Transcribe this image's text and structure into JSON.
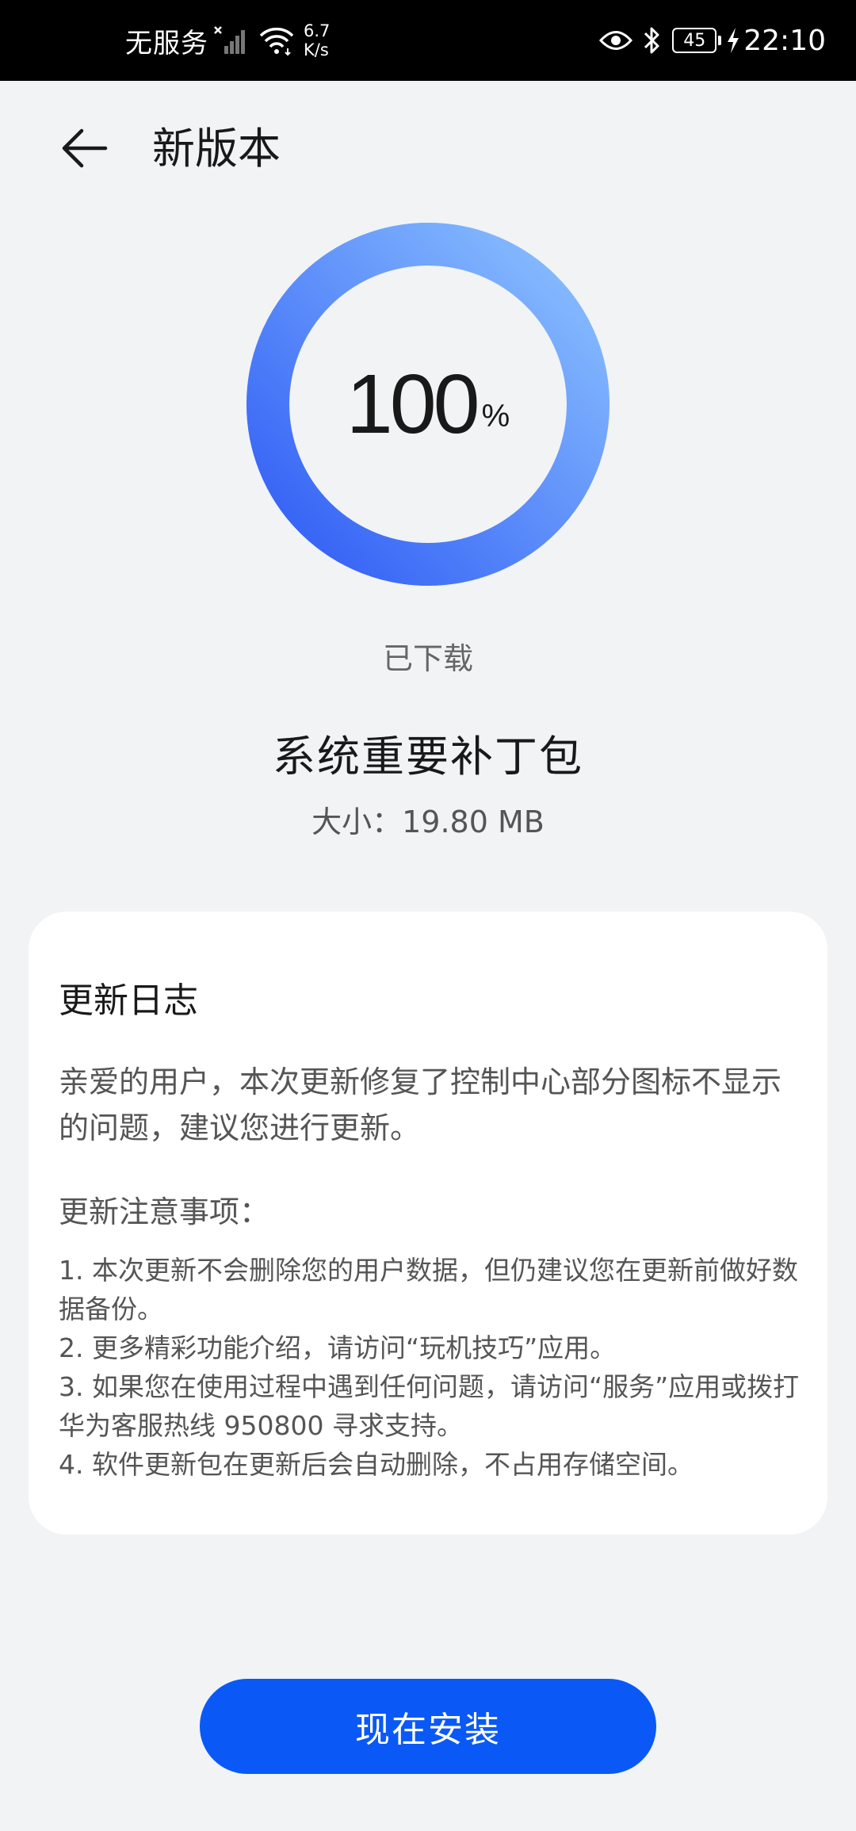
{
  "status_bar": {
    "carrier": "无服务",
    "net_speed_value": "6.7",
    "net_speed_unit": "K/s",
    "battery": "45",
    "time": "22:10",
    "icons": [
      "no-signal-icon",
      "wifi-icon",
      "eye-comfort-icon",
      "bluetooth-icon",
      "battery-icon",
      "charging-icon"
    ]
  },
  "header": {
    "back_icon": "back-arrow-icon",
    "title": "新版本"
  },
  "progress": {
    "value": "100",
    "unit": "%",
    "fraction": 1.0,
    "colors": {
      "start": "#2f5bf5",
      "end": "#8cc2ff"
    }
  },
  "download_status": "已下载",
  "package": {
    "name": "系统重要补丁包",
    "size": "大小：19.80 MB"
  },
  "changelog": {
    "title": "更新日志",
    "intro": "亲爱的用户，本次更新修复了控制中心部分图标不显示的问题，建议您进行更新。",
    "notes_title": "更新注意事项：",
    "notes": [
      "1. 本次更新不会删除您的用户数据，但仍建议您在更新前做好数据备份。",
      "2. 更多精彩功能介绍，请访问“玩机技巧”应用。",
      "3. 如果您在使用过程中遇到任何问题，请访问“服务”应用或拨打华为客服热线 950800 寻求支持。",
      "4. 软件更新包在更新后会自动删除，不占用存储空间。"
    ]
  },
  "install_button": {
    "label": "现在安装",
    "color": "#0a59f7"
  }
}
